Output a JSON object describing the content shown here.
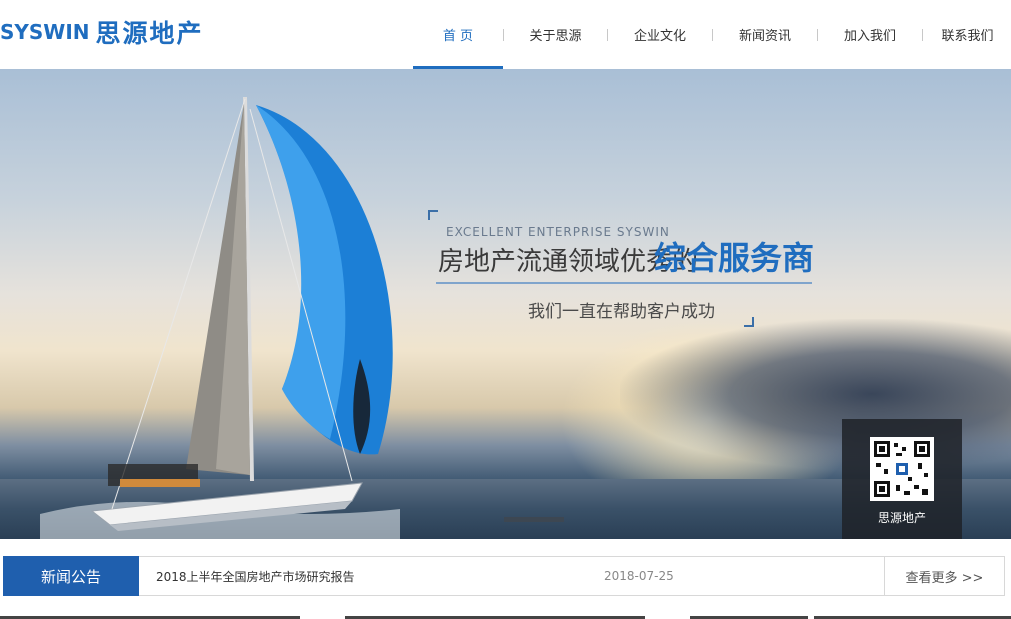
{
  "header": {
    "logo_en": "SYSWIN",
    "logo_cn": "思源地产",
    "nav": [
      {
        "label": "首 页",
        "active": true
      },
      {
        "label": "关于思源",
        "active": false
      },
      {
        "label": "企业文化",
        "active": false
      },
      {
        "label": "新闻资讯",
        "active": false
      },
      {
        "label": "加入我们",
        "active": false
      },
      {
        "label": "联系我们",
        "active": false
      }
    ]
  },
  "banner": {
    "slogan_en": "EXCELLENT ENTERPRISE  SYSWIN",
    "slogan_main": "房地产流通领域优秀的",
    "slogan_strong": "综合服务商",
    "slogan_sub": "我们一直在帮助客户成功",
    "qr_caption": "思源地产"
  },
  "news": {
    "label": "新闻公告",
    "title": "2018上半年全国房地产市场研究报告",
    "date": "2018-07-25",
    "more": "查看更多 >>"
  },
  "colors": {
    "brand": "#1f6dbf",
    "news_label_bg": "#1f5fae"
  }
}
